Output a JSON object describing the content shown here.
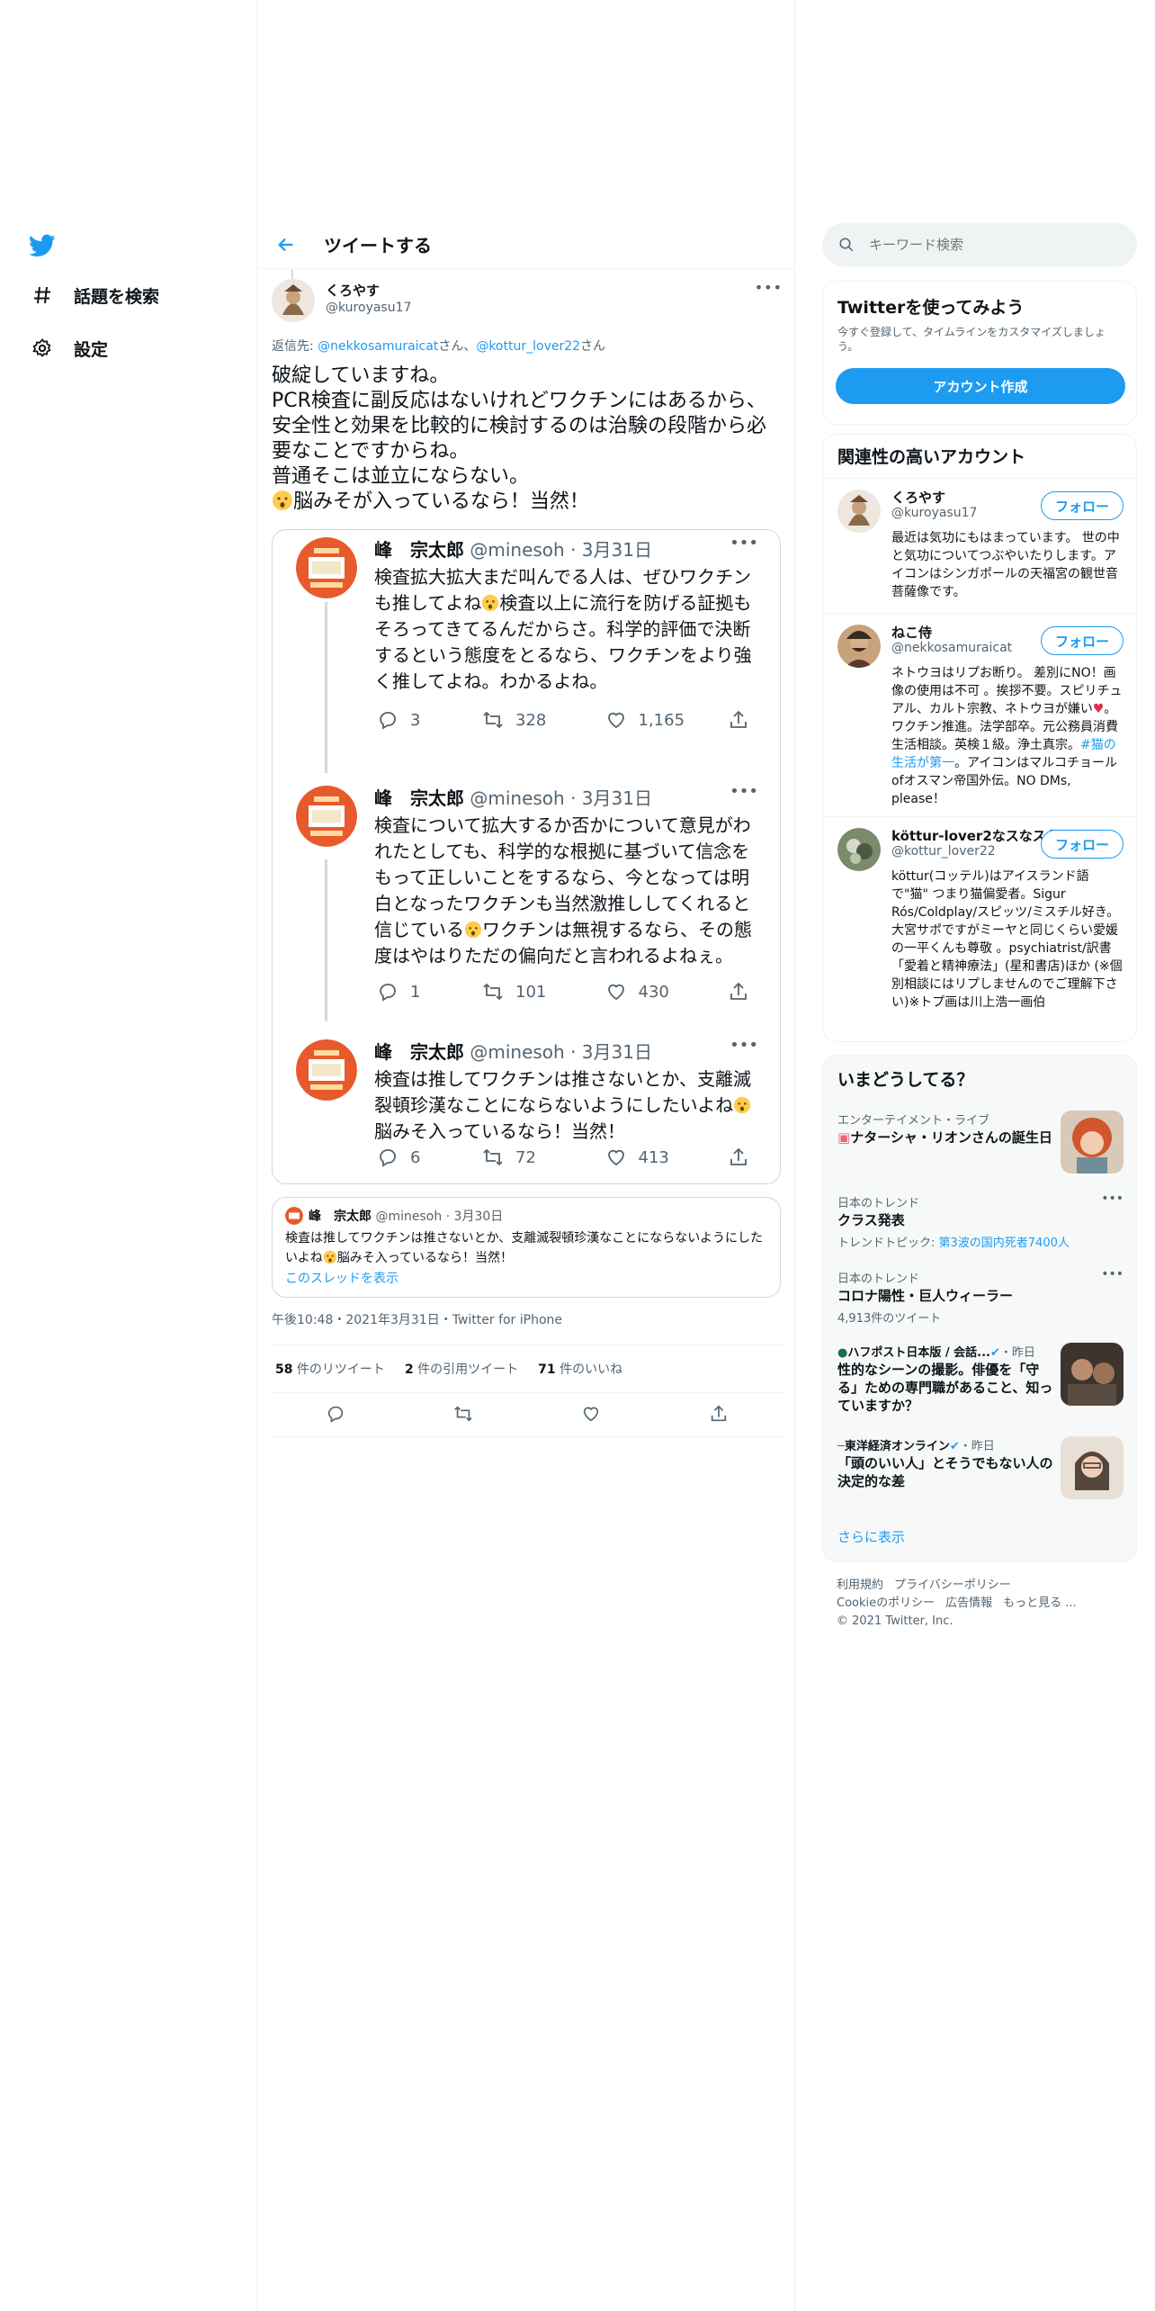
{
  "nav": {
    "explore_label": "話題を検索",
    "settings_label": "設定"
  },
  "header": {
    "title": "ツイートする"
  },
  "tweet": {
    "author_name": "くろやす",
    "author_handle": "@kuroyasu17",
    "reply_prefix": "返信先: ",
    "reply_user1": "@nekkosamuraicat",
    "reply_mid": "さん、",
    "reply_user2": "@kottur_lover22",
    "reply_suffix": "さん",
    "text_main": "破綻していますね。\nPCR検査に副反応はないけれどワクチンにはあるから、安全性と効果を比較的に検討するのは治験の段階から必要なことですからね。\n普通そこは並立にならない。",
    "text_last": "脳みそが入っているなら！当然！",
    "meta": "午後10:48・2021年3月31日・Twitter for iPhone",
    "retweet_count": "58",
    "retweet_label": " 件のリツイート",
    "quote_count": "2",
    "quote_label": " 件の引用ツイート",
    "like_count": "71",
    "like_label": " 件のいいね"
  },
  "thread": {
    "name": "峰　宗太郎",
    "handle_date": "@minesoh · 3月31日",
    "items": [
      {
        "text_a": "検査拡大拡大まだ叫んでる人は、ぜひワクチンも推してよね",
        "text_b": "検査以上に流行を防げる証拠もそろってきてるんだからさ。科学的評価で決断するという態度をとるなら、ワクチンをより強く推してよね。わかるよね。",
        "replies": "3",
        "retweets": "328",
        "likes": "1,165"
      },
      {
        "text_a": "検査について拡大するか否かについて意見がわれたとしても、科学的な根拠に基づいて信念をもって正しいことをするなら、今となっては明白となったワクチンも当然激推ししてくれると信じている",
        "text_b": "ワクチンは無視するなら、その態度はやはりただの偏向だと言われるよねぇ。",
        "replies": "1",
        "retweets": "101",
        "likes": "430"
      },
      {
        "text_a": "検査は推してワクチンは推さないとか、支離滅裂頓珍漢なことにならないようにしたいよね",
        "text_b": "脳みそ入っているなら！当然！",
        "replies": "6",
        "retweets": "72",
        "likes": "413"
      }
    ]
  },
  "quote": {
    "name": "峰　宗太郎",
    "handle_date": "@minesoh · 3月30日",
    "text_a": "検査は推してワクチンは推さないとか、支離滅裂頓珍漢なことにならないようにしたいよね",
    "text_b": "脳みそ入っているなら！当然！",
    "link": "このスレッドを表示"
  },
  "search": {
    "placeholder": "キーワード検索"
  },
  "signup": {
    "title": "Twitterを使ってみよう",
    "desc": "今すぐ登録して、タイムラインをカスタマイズしましょう。",
    "button": "アカウント作成"
  },
  "related": {
    "title": "関連性の高いアカウント",
    "follow_label": "フォロー",
    "accounts": [
      {
        "name": "くろやす",
        "handle": "@kuroyasu17",
        "bio": "最近は気功にもはまっています。 世の中と気功についてつぶやいたりします。アイコンはシンガポールの天福宮の観世音菩薩像です。"
      },
      {
        "name": "ねこ侍",
        "handle": "@nekkosamuraicat",
        "bio_a": "ネトウヨはリプお断り。 差別にNO！画像の使用は不可 。挨拶不要。スピリチュアル、カルト宗教、ネトウヨが嫌い",
        "bio_b": "。ワクチン推進。法学部卒。元公務員消費生活相談。英検１級。浄土真宗。",
        "bio_link": "#猫の生活が第一",
        "bio_c": "。アイコンはマルコチョールofオスマン帝国外伝。NO DMs, please！"
      },
      {
        "name": "köttur-lover2なスなスな",
        "handle": "@kottur_lover22",
        "bio": "köttur(コッテル)はアイスランド語で\"猫\" つまり猫偏愛者。Sigur Rós/Coldplay/スピッツ/ミスチル好き。大宮サポですがミーヤと同じくらい愛媛の一平くんも尊敬 。psychiatrist/訳書 「愛着と精神療法」(星和書店)ほか (※個別相談にはリプしませんのでご理解下さい)※トプ画は川上浩一画伯"
      }
    ]
  },
  "trends": {
    "title": "いまどうしてる？",
    "items": [
      {
        "category": "エンターテイメント・ライブ",
        "name": "ナターシャ・リオンさんの誕生日"
      },
      {
        "category": "日本のトレンド",
        "name": "クラス発表",
        "sub_prefix": "トレンドトピック: ",
        "sub_link": "第3波の国内死者7400人"
      },
      {
        "category": "日本のトレンド",
        "name": "コロナ陽性・巨人ウィーラー",
        "sub": "4,913件のツイート"
      },
      {
        "category": "ハフポスト日本版 / 会話...",
        "category_time": "・昨日",
        "name": "性的なシーンの撮影。俳優を「守る」ための専門職があること、知っていますか？"
      },
      {
        "category": "東洋経済オンライン",
        "category_time": "・昨日",
        "name": "「頭のいい人」とそうでもない人の決定的な差"
      }
    ],
    "show_more": "さらに表示"
  },
  "footer": {
    "links": [
      "利用規約",
      "プライバシーポリシー",
      "Cookieのポリシー",
      "広告情報",
      "もっと見る ..."
    ],
    "copyright": "© 2021 Twitter, Inc."
  },
  "colors": {
    "accent": "#1d9bf0",
    "text": "#0f1419",
    "secondary": "#536471",
    "border": "#eff3f4"
  }
}
